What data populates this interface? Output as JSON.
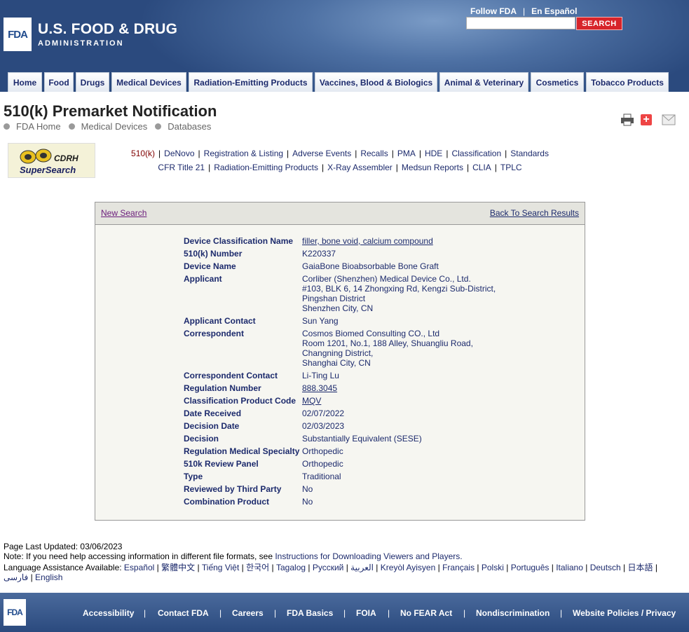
{
  "header": {
    "logo_mark": "FDA",
    "title": "U.S. FOOD & DRUG",
    "subtitle": "ADMINISTRATION",
    "follow": "Follow FDA",
    "espanol": "En Español",
    "search_button": "SEARCH",
    "search_value": ""
  },
  "nav": [
    {
      "label": "Home"
    },
    {
      "label": "Food"
    },
    {
      "label": "Drugs"
    },
    {
      "label": "Medical Devices"
    },
    {
      "label": "Radiation-Emitting Products"
    },
    {
      "label": "Vaccines, Blood & Biologics"
    },
    {
      "label": "Animal & Veterinary"
    },
    {
      "label": "Cosmetics"
    },
    {
      "label": "Tobacco Products"
    }
  ],
  "page": {
    "title": "510(k) Premarket Notification",
    "breadcrumbs": [
      "FDA Home",
      "Medical Devices",
      "Databases"
    ]
  },
  "cdrh": {
    "line1": "CDRH",
    "line2": "SuperSearch",
    "links_row1": [
      "510(k)",
      "DeNovo",
      "Registration & Listing",
      "Adverse Events",
      "Recalls",
      "PMA",
      "HDE",
      "Classification",
      "Standards"
    ],
    "links_row2": [
      "CFR Title 21",
      "Radiation-Emitting Products",
      "X-Ray Assembler",
      "Medsun Reports",
      "CLIA",
      "TPLC"
    ]
  },
  "panel": {
    "new_search": "New Search",
    "back_results": "Back To Search Results",
    "fields": [
      {
        "label": "Device Classification Name",
        "value": [
          "filler, bone void, calcium compound"
        ],
        "link": true
      },
      {
        "label": "510(k) Number",
        "value": [
          "K220337"
        ]
      },
      {
        "label": "Device Name",
        "value": [
          "GaiaBone Bioabsorbable Bone Graft"
        ]
      },
      {
        "label": "Applicant",
        "value": [
          "Corliber (Shenzhen) Medical Device Co., Ltd.",
          "#103, BLK 6, 14 Zhongxing Rd, Kengzi Sub-District,",
          "Pingshan District",
          "Shenzhen City,  CN"
        ]
      },
      {
        "label": "Applicant Contact",
        "value": [
          "Sun Yang"
        ]
      },
      {
        "label": "Correspondent",
        "value": [
          "Cosmos Biomed Consulting CO., Ltd",
          "Room 1201, No.1, 188 Alley, Shuangliu Road,",
          "Changning District,",
          "Shanghai City,  CN"
        ]
      },
      {
        "label": "Correspondent Contact",
        "value": [
          "Li-Ting Lu"
        ]
      },
      {
        "label": "Regulation Number",
        "value": [
          "888.3045"
        ],
        "link": true
      },
      {
        "label": "Classification Product Code",
        "value": [
          "MQV"
        ],
        "link": true
      },
      {
        "label": "Date Received",
        "value": [
          "02/07/2022"
        ]
      },
      {
        "label": "Decision Date",
        "value": [
          "02/03/2023"
        ]
      },
      {
        "label": "Decision",
        "value": [
          "Substantially Equivalent (SESE)"
        ]
      },
      {
        "label": "Regulation Medical Specialty",
        "value": [
          "Orthopedic"
        ]
      },
      {
        "label": "510k Review Panel",
        "value": [
          "Orthopedic"
        ]
      },
      {
        "label": "Type",
        "value": [
          "Traditional"
        ]
      },
      {
        "label": "Reviewed by Third Party",
        "value": [
          "No"
        ]
      },
      {
        "label": "Combination Product",
        "value": [
          "No"
        ]
      }
    ]
  },
  "notes": {
    "updated": "Page Last Updated: 03/06/2023",
    "note_prefix": "Note: If you need help accessing information in different file formats, see ",
    "note_link": "Instructions for Downloading Viewers and Players.",
    "lang_prefix": "Language Assistance Available: ",
    "languages": [
      "Español",
      "繁體中文",
      "Tiếng Việt",
      "한국어",
      "Tagalog",
      "Русский",
      "العربية",
      "Kreyòl Ayisyen",
      "Français",
      "Polski",
      "Português",
      "Italiano",
      "Deutsch",
      "日本語",
      "فارسی",
      "English"
    ]
  },
  "footer": {
    "logo_mark": "FDA",
    "links": [
      "Accessibility",
      "Contact FDA",
      "Careers",
      "FDA Basics",
      "FOIA",
      "No FEAR Act",
      "Nondiscrimination",
      "Website Policies / Privacy"
    ]
  }
}
